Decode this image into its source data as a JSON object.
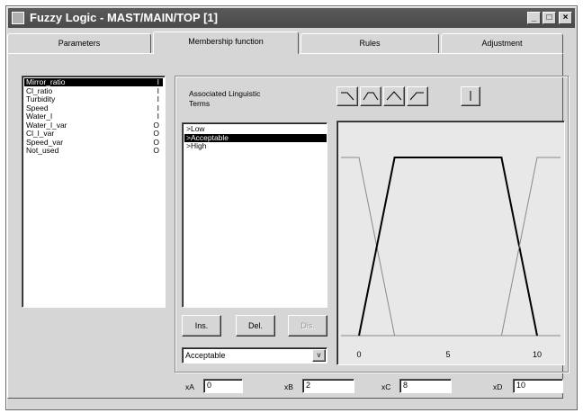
{
  "window": {
    "title": "Fuzzy Logic - MAST/MAIN/TOP [1]"
  },
  "tabs": [
    "Parameters",
    "Membership function",
    "Rules",
    "Adjustment"
  ],
  "variables": [
    {
      "name": "Mirror_ratio",
      "io": "I"
    },
    {
      "name": "Cl_ratio",
      "io": "I"
    },
    {
      "name": "Turbidity",
      "io": "I"
    },
    {
      "name": "Speed",
      "io": "I"
    },
    {
      "name": "Water_l",
      "io": "I"
    },
    {
      "name": "Water_l_var",
      "io": "O"
    },
    {
      "name": "Cl_l_var",
      "io": "O"
    },
    {
      "name": "Speed_var",
      "io": "O"
    },
    {
      "name": "Not_used",
      "io": "O"
    }
  ],
  "terms_label": "Associated Linguistic Terms",
  "terms": [
    ">Low",
    ">Acceptable",
    ">High"
  ],
  "buttons": {
    "ins": "Ins.",
    "del": "Del.",
    "dis": "Dis."
  },
  "term_select_value": "Acceptable",
  "chart": {
    "x_ticks": [
      "0",
      "5",
      "10"
    ]
  },
  "params": {
    "a_label": "xA",
    "a_value": "0",
    "b_label": "xB",
    "b_value": "2",
    "c_label": "xC",
    "c_value": "8",
    "d_label": "xD",
    "d_value": "10"
  },
  "chart_data": {
    "type": "line",
    "x_range": [
      0,
      10
    ],
    "y_range": [
      0,
      1
    ],
    "series": [
      {
        "x": [
          -2,
          0,
          2
        ],
        "y": [
          1,
          1,
          0
        ]
      },
      {
        "x": [
          0,
          2,
          8,
          10
        ],
        "y": [
          0,
          1,
          1,
          0
        ]
      },
      {
        "x": [
          8,
          10,
          12
        ],
        "y": [
          0,
          1,
          1
        ]
      }
    ],
    "x_ticks": [
      0,
      5,
      10
    ]
  }
}
